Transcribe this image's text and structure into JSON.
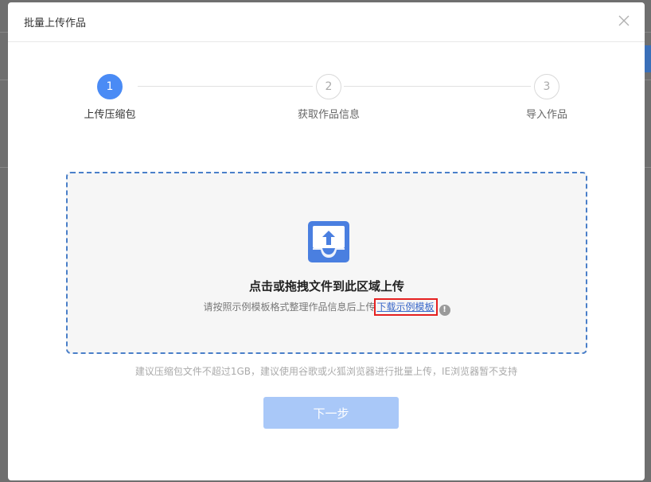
{
  "modal": {
    "title": "批量上传作品"
  },
  "steps": [
    {
      "number": "1",
      "label": "上传压缩包",
      "state": "active"
    },
    {
      "number": "2",
      "label": "获取作品信息",
      "state": "pending"
    },
    {
      "number": "3",
      "label": "导入作品",
      "state": "pending"
    }
  ],
  "dropzone": {
    "title": "点击或拖拽文件到此区域上传",
    "hint": "请按照示例模板格式整理作品信息后上传",
    "template_link": "下载示例模板",
    "info_glyph": "!"
  },
  "note": "建议压缩包文件不超过1GB，建议使用谷歌或火狐浏览器进行批量上传，IE浏览器暂不支持",
  "next_button": "下一步",
  "colors": {
    "accent": "#4a8bf5",
    "dropzone_border": "#4a7fc9",
    "highlight_box": "#e52020",
    "disabled_button": "#a9c8f8"
  }
}
